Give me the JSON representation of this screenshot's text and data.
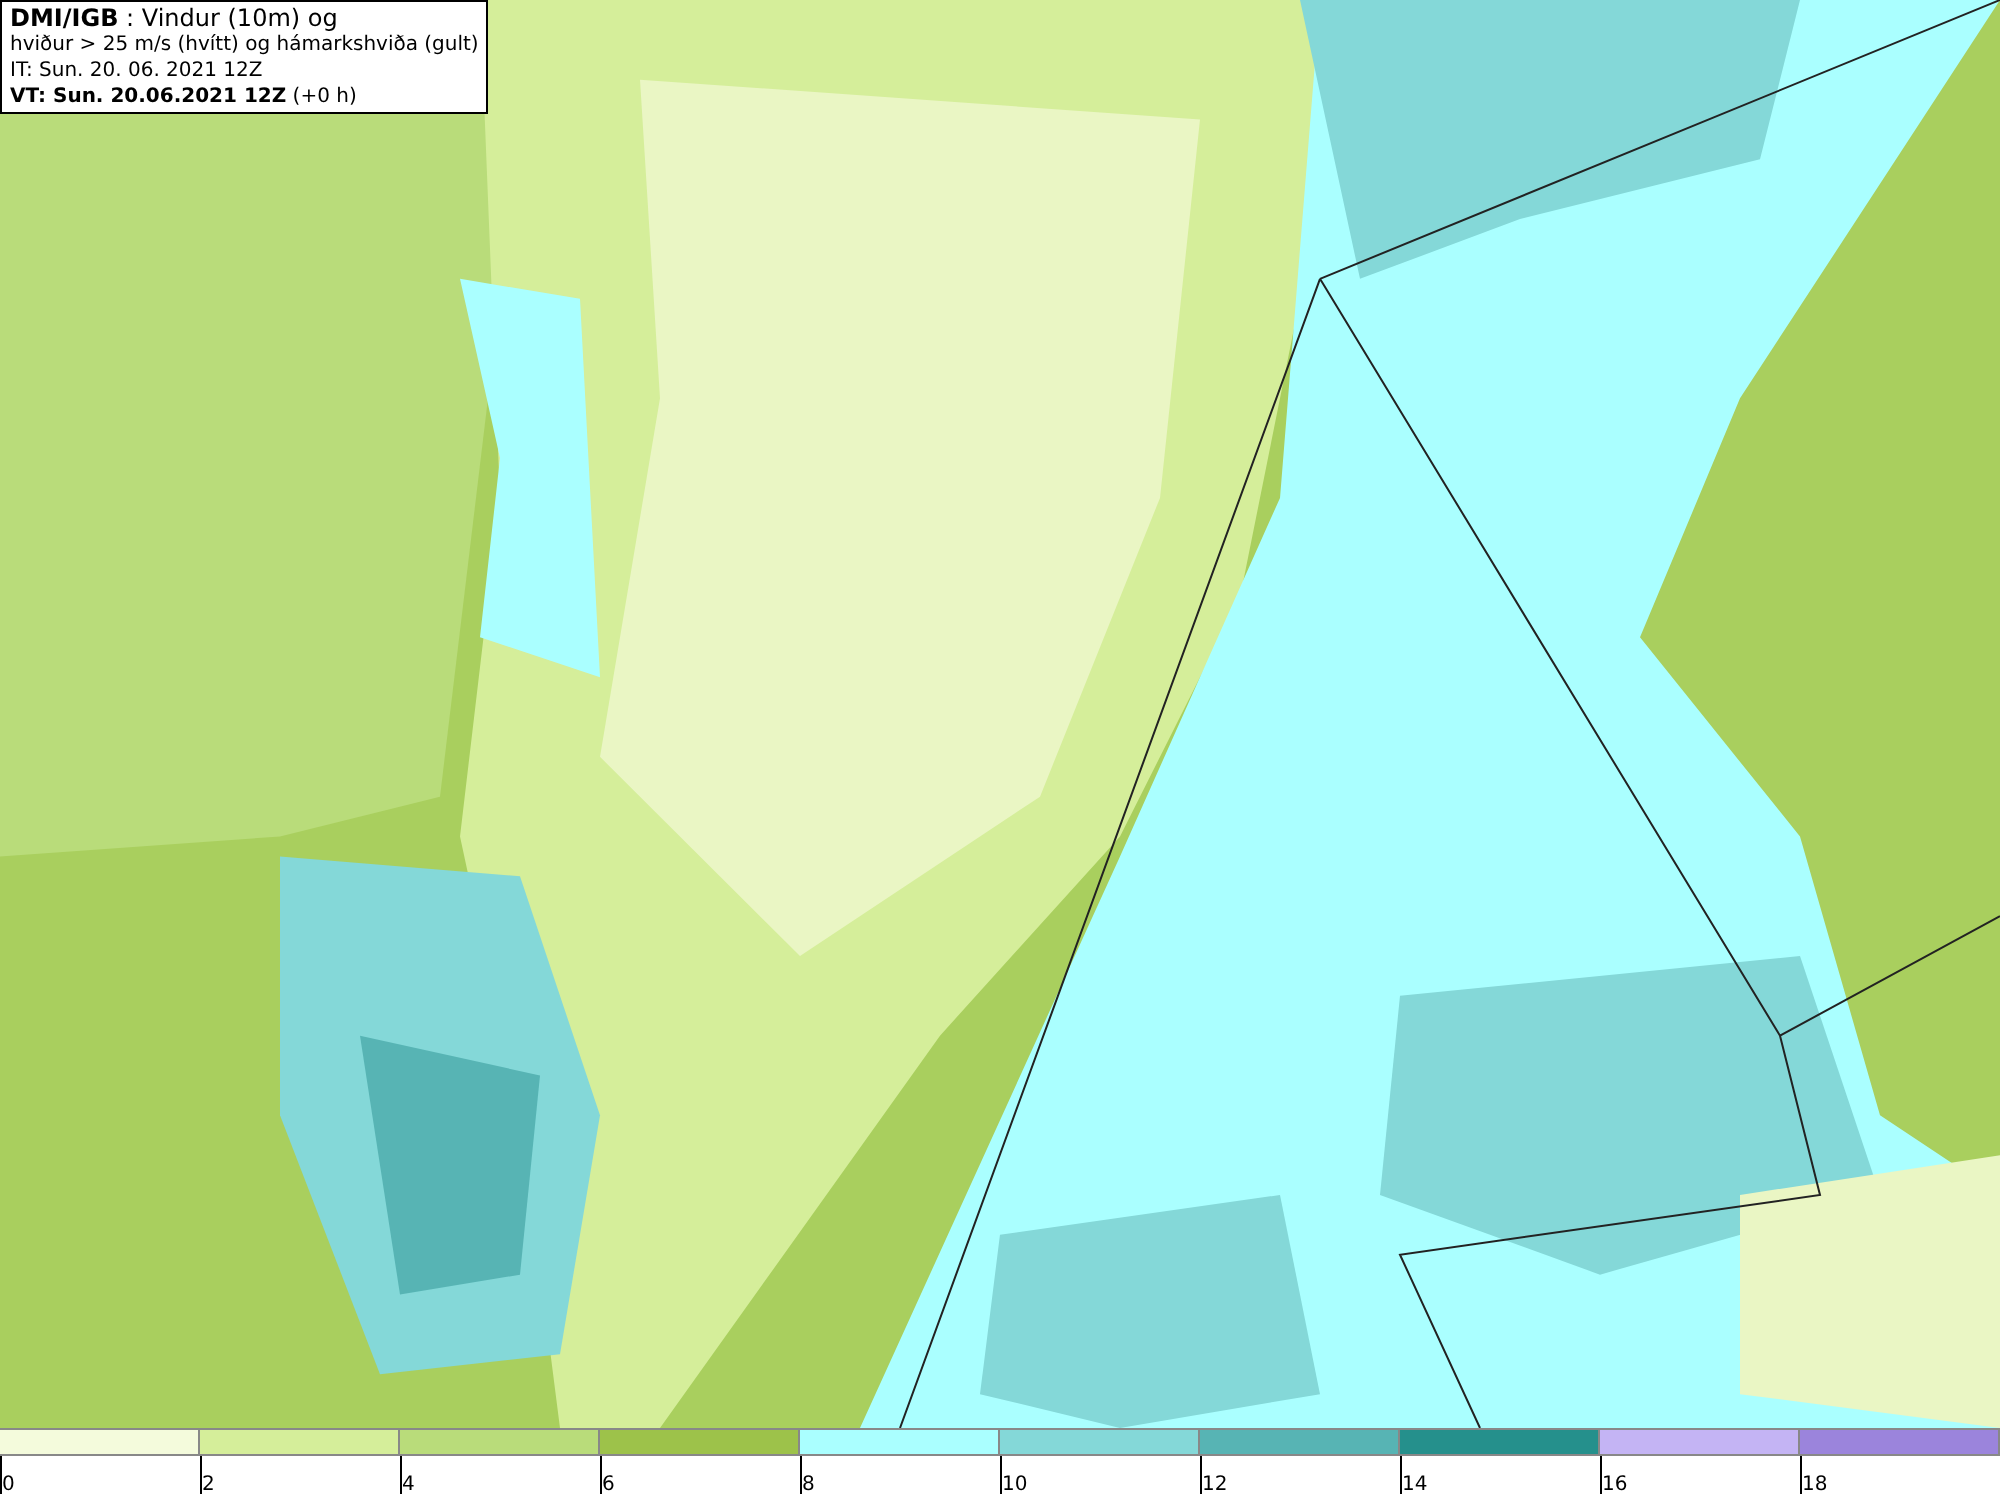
{
  "title_box": {
    "lines": [
      "**DMI/IGB** : Vindur (10m) og",
      "hviður > 25 m/s (hvítt) og hámarkshviða (gult)",
      "IT: Sun. 20. 06. 2021 12Z",
      "**VT: Sun. 20.06.2021 12Z** (+0 h)"
    ]
  },
  "legend": {
    "segments": [
      {
        "label": "0",
        "color": "#f4fbdc"
      },
      {
        "label": "2",
        "color": "#d5ee9a"
      },
      {
        "label": "4",
        "color": "#b9dc7a"
      },
      {
        "label": "6",
        "color": "#9dc24a"
      },
      {
        "label": "8",
        "color": "#aaffff"
      },
      {
        "label": "10",
        "color": "#84d8d8"
      },
      {
        "label": "12",
        "color": "#57b4b4"
      },
      {
        "label": "14",
        "color": "#25908c"
      },
      {
        "label": "16",
        "color": "#c4b4f4"
      },
      {
        "label": "18",
        "color": "#9b84dc"
      }
    ]
  }
}
